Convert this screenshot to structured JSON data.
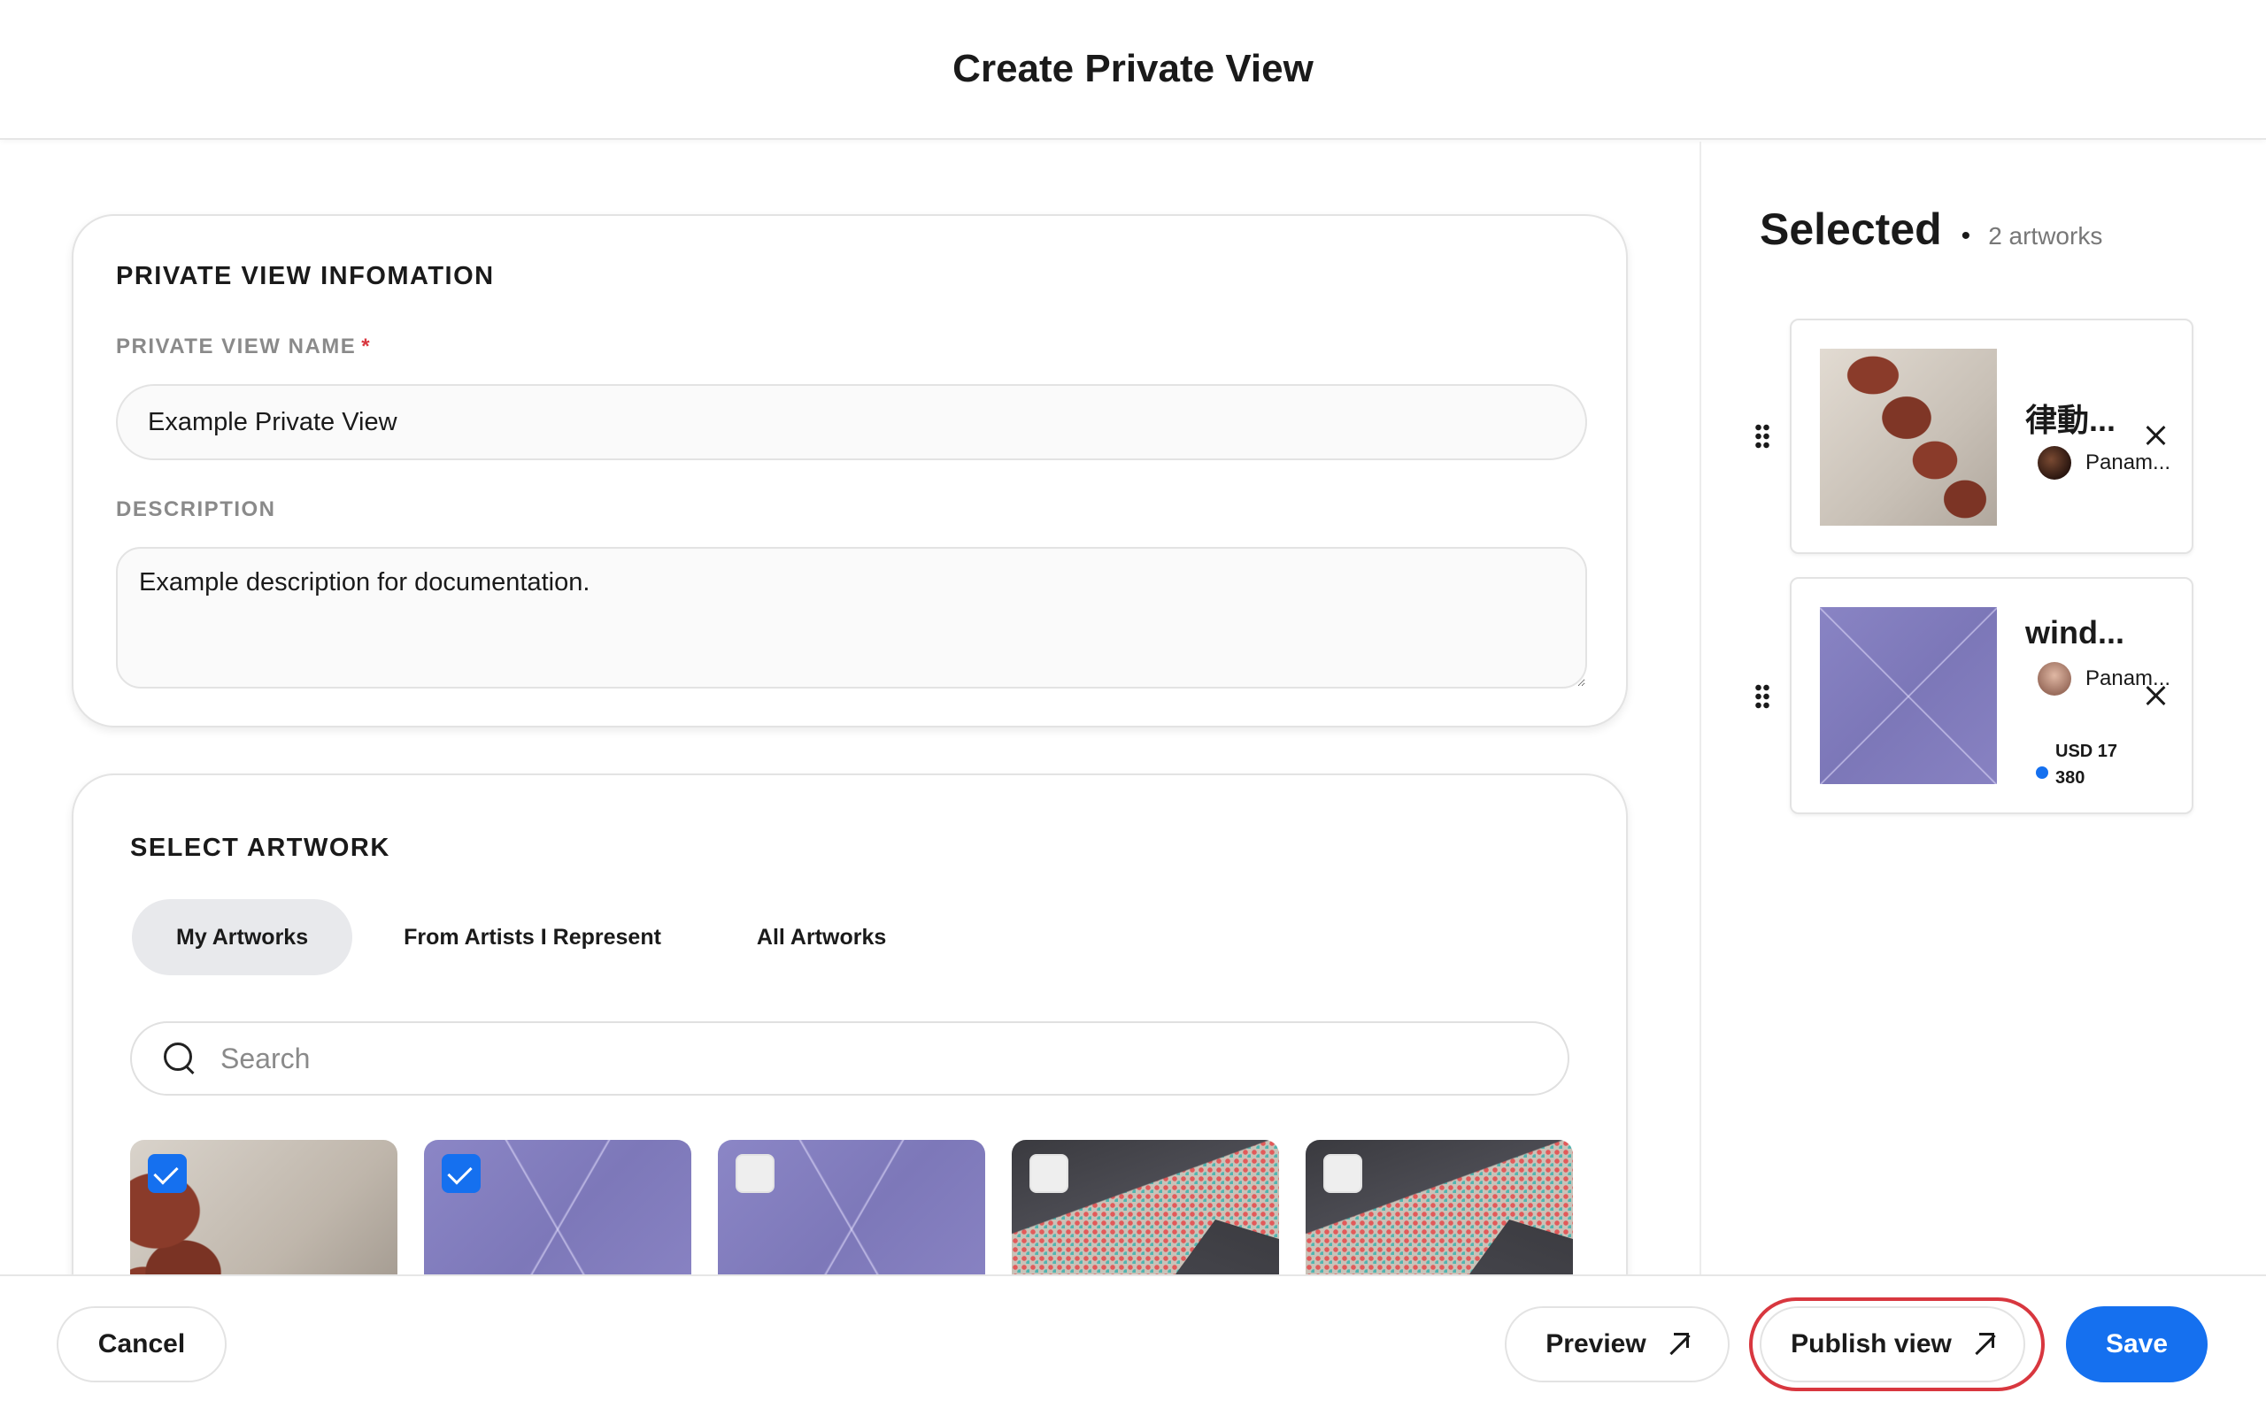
{
  "header": {
    "title": "Create Private View"
  },
  "info": {
    "section_title": "PRIVATE VIEW INFOMATION",
    "name_label": "PRIVATE VIEW NAME",
    "required_mark": "*",
    "name_value": "Example Private View",
    "description_label": "DESCRIPTION",
    "description_value": "Example description for documentation."
  },
  "select": {
    "section_title": "SELECT ARTWORK",
    "tabs": [
      {
        "label": "My Artworks",
        "active": true
      },
      {
        "label": "From Artists I Represent",
        "active": false
      },
      {
        "label": "All Artworks",
        "active": false
      }
    ],
    "search_placeholder": "Search",
    "artworks": [
      {
        "checked": true,
        "style": "clay"
      },
      {
        "checked": true,
        "style": "lavender"
      },
      {
        "checked": false,
        "style": "lavender"
      },
      {
        "checked": false,
        "style": "pattern"
      },
      {
        "checked": false,
        "style": "pattern"
      }
    ]
  },
  "selected": {
    "title": "Selected",
    "separator": "•",
    "count_label": "2 artworks",
    "items": [
      {
        "name": "律動...",
        "artist": "Panam..."
      },
      {
        "name": "wind...",
        "artist": "Panam...",
        "price": "USD 17 380"
      }
    ]
  },
  "footer": {
    "cancel_label": "Cancel",
    "preview_label": "Preview",
    "publish_label": "Publish view",
    "save_label": "Save"
  },
  "colors": {
    "accent": "#1570ef",
    "highlight_ring": "#d8373f",
    "required": "#d8373f"
  }
}
